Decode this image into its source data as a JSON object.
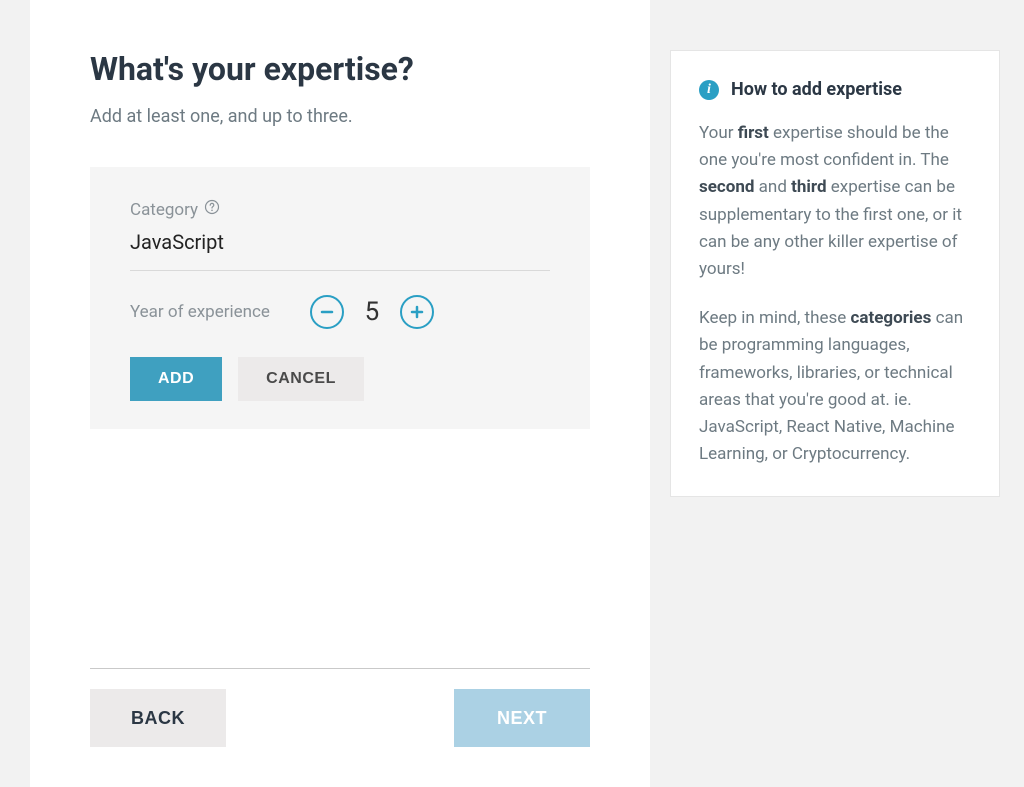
{
  "main": {
    "title": "What's your expertise?",
    "subtitle": "Add at least one, and up to three.",
    "card": {
      "category_label": "Category",
      "category_value": "JavaScript",
      "experience_label": "Year of experience",
      "experience_value": "5",
      "add_label": "ADD",
      "cancel_label": "CANCEL"
    },
    "nav": {
      "back_label": "BACK",
      "next_label": "NEXT"
    }
  },
  "sidebar": {
    "title": "How to add expertise",
    "paragraph1": {
      "pre": "Your ",
      "b1": "first",
      "mid1": " expertise should be the one you're most confident in. The ",
      "b2": "second",
      "mid2": " and ",
      "b3": "third",
      "post": " expertise can be supplementary to the first one, or it can be any other killer expertise of yours!"
    },
    "paragraph2": {
      "pre": "Keep in mind, these ",
      "b1": "categories",
      "post": " can be programming languages, frameworks, libraries, or technical areas that you're good at. ie. JavaScript, React Native, Machine Learning, or Cryptocurrency."
    }
  },
  "icons": {
    "info": "i"
  },
  "colors": {
    "accent": "#2a9fc4",
    "button_primary": "#3fa0c0",
    "button_next": "#abd1e4",
    "text_dark": "#2b3744",
    "text_muted": "#6d7a82"
  }
}
